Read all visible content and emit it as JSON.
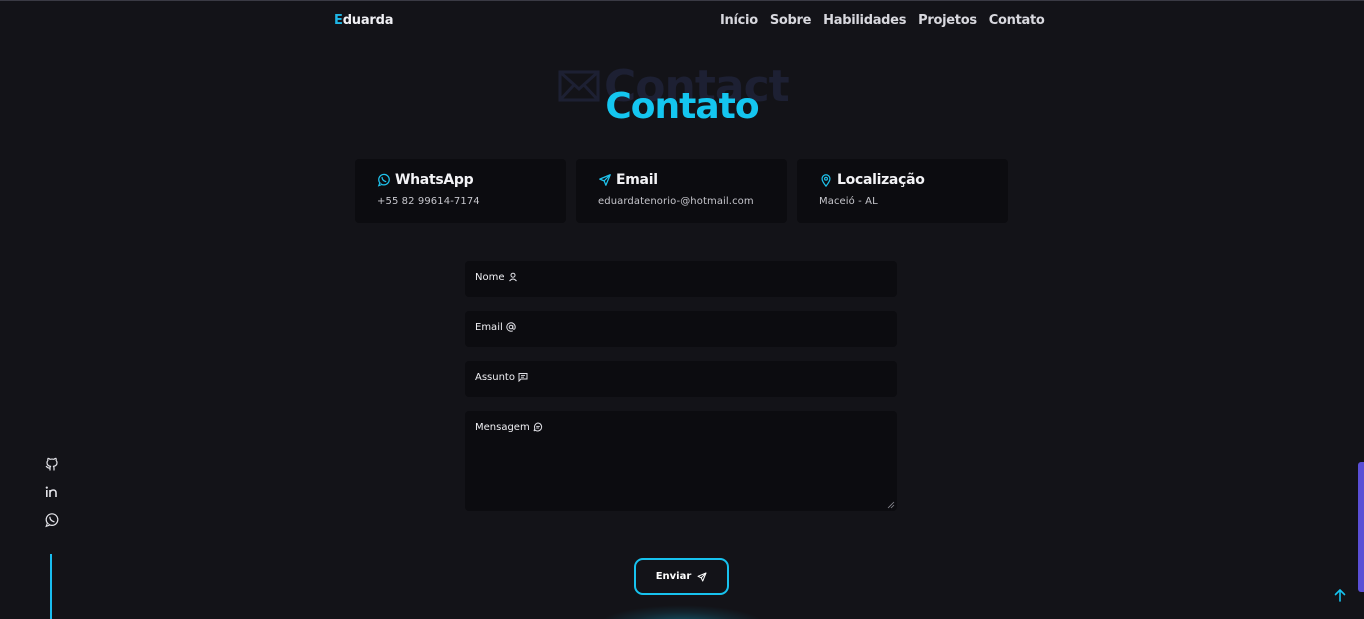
{
  "header": {
    "logo_initial": "E",
    "logo_rest": "duarda",
    "nav": [
      "Início",
      "Sobre",
      "Habilidades",
      "Projetos",
      "Contato"
    ]
  },
  "section": {
    "bg_title": "Contact",
    "title": "Contato"
  },
  "cards": [
    {
      "icon": "whatsapp-icon",
      "title": "WhatsApp",
      "text": "+55 82 99614-7174"
    },
    {
      "icon": "send-icon",
      "title": "Email",
      "text": "eduardatenorio-@hotmail.com"
    },
    {
      "icon": "location-pin-icon",
      "title": "Localização",
      "text": "Maceió - AL"
    }
  ],
  "form": {
    "name_label": "Nome",
    "email_label": "Email",
    "subject_label": "Assunto",
    "message_label": "Mensagem",
    "submit_label": "Enviar"
  },
  "social": [
    "github-icon",
    "linkedin-icon",
    "whatsapp-icon"
  ],
  "colors": {
    "background": "#131318",
    "accent": "#14c6f0",
    "card_bg": "#0c0c10",
    "scrollbar": "#5a4fd6"
  }
}
